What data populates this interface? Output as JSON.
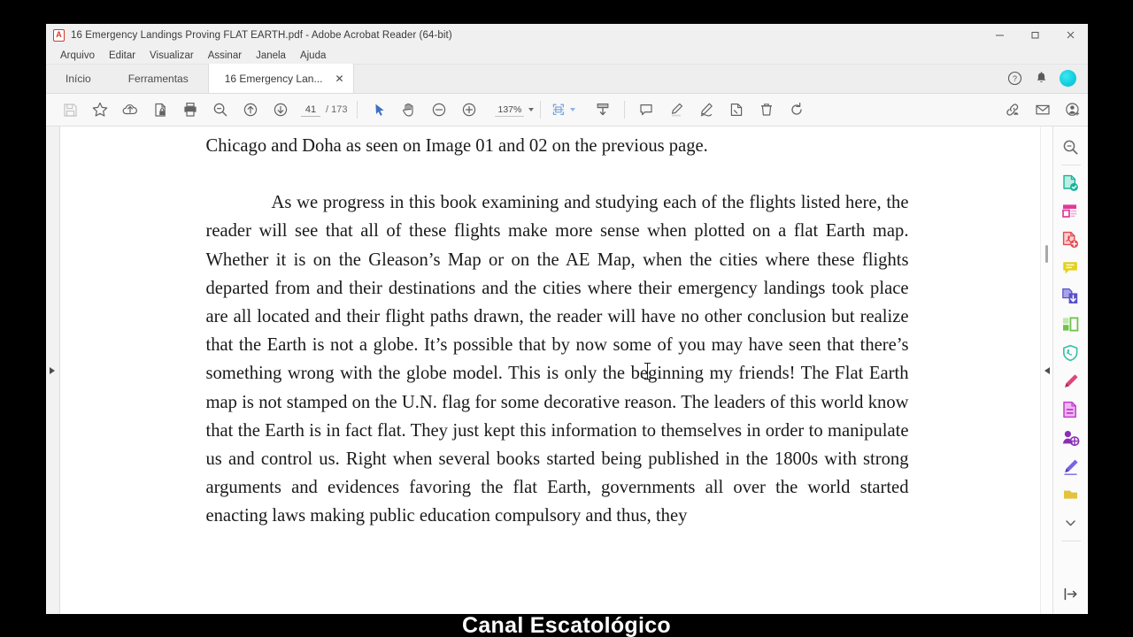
{
  "window": {
    "app_icon_glyph": "A",
    "title": "16 Emergency Landings Proving FLAT EARTH.pdf - Adobe Acrobat Reader (64-bit)",
    "controls": {
      "minimize": "–",
      "restore": "❐",
      "close": "✕"
    }
  },
  "menubar": {
    "items": [
      {
        "label": "Arquivo"
      },
      {
        "label": "Editar"
      },
      {
        "label": "Visualizar"
      },
      {
        "label": "Assinar"
      },
      {
        "label": "Janela"
      },
      {
        "label": "Ajuda"
      }
    ]
  },
  "tabs": {
    "home": "Início",
    "tools": "Ferramentas",
    "document": "16 Emergency Lan...",
    "close_glyph": "✕",
    "right_icons": [
      {
        "name": "help-icon",
        "glyph": "?"
      },
      {
        "name": "notification-bell-icon",
        "glyph": "🔔"
      },
      {
        "name": "user-avatar",
        "glyph": ""
      }
    ]
  },
  "toolbar": {
    "icons": [
      {
        "name": "save-icon",
        "label": "Salvar"
      },
      {
        "name": "star-bookmark-icon",
        "label": "Favorito"
      },
      {
        "name": "cloud-upload-icon",
        "label": "Enviar para nuvem"
      },
      {
        "name": "protect-document-icon",
        "label": "Proteger"
      },
      {
        "name": "print-icon",
        "label": "Imprimir"
      },
      {
        "name": "search-zoom-icon",
        "label": "Pesquisar"
      },
      {
        "name": "previous-page-icon",
        "label": "Página anterior"
      },
      {
        "name": "next-page-icon",
        "label": "Próxima página"
      }
    ],
    "page_current": "41",
    "page_separator": "/",
    "page_total": "173",
    "cursor_tools": [
      {
        "name": "select-tool-icon",
        "label": "Selecionar",
        "active": true
      },
      {
        "name": "hand-tool-icon",
        "label": "Mão"
      }
    ],
    "zoom_out": {
      "name": "zoom-out-icon",
      "label": "Reduzir"
    },
    "zoom_in": {
      "name": "zoom-in-icon",
      "label": "Ampliar"
    },
    "zoom_level": "137%",
    "fit_page": {
      "name": "fit-page-icon",
      "label": "Ajustar página"
    },
    "scroll_mode": {
      "name": "scroll-mode-icon",
      "label": "Modo de rolagem"
    },
    "annotate_icons": [
      {
        "name": "comment-icon",
        "label": "Comentário"
      },
      {
        "name": "highlight-icon",
        "label": "Realce"
      },
      {
        "name": "draw-icon",
        "label": "Desenhar"
      },
      {
        "name": "stamp-icon",
        "label": "Carimbo"
      },
      {
        "name": "delete-icon",
        "label": "Excluir"
      },
      {
        "name": "rotate-icon",
        "label": "Girar"
      }
    ],
    "share_icons": [
      {
        "name": "share-link-icon",
        "label": "Compartilhar link"
      },
      {
        "name": "email-icon",
        "label": "Enviar por e-mail"
      },
      {
        "name": "add-person-icon",
        "label": "Adicionar pessoa"
      }
    ]
  },
  "right_rail": {
    "items": [
      {
        "name": "search-document-icon",
        "label": "Pesquisar documento",
        "color": "#6d6d6d"
      },
      {
        "name": "export-pdf-icon",
        "label": "Exportar PDF",
        "color": "#17b39b"
      },
      {
        "name": "organize-pages-icon",
        "label": "Organizar páginas",
        "color": "#e0399a"
      },
      {
        "name": "create-pdf-icon",
        "label": "Criar PDF",
        "color": "#e5484d"
      },
      {
        "name": "comment-tool-icon",
        "label": "Comentário",
        "color": "#d6c020"
      },
      {
        "name": "combine-files-icon",
        "label": "Combinar arquivos",
        "color": "#5a52c9"
      },
      {
        "name": "compress-pdf-icon",
        "label": "Compactar PDF",
        "color": "#6ec34a"
      },
      {
        "name": "protect-pdf-icon",
        "label": "Proteger PDF",
        "color": "#37bfa7"
      },
      {
        "name": "fill-sign-icon",
        "label": "Preencher e assinar",
        "color": "#e0447a"
      },
      {
        "name": "edit-pdf-icon",
        "label": "Editar PDF",
        "color": "#c53bd0"
      },
      {
        "name": "request-signature-icon",
        "label": "Solicitar assinatura",
        "color": "#8a2fb5"
      },
      {
        "name": "stamp-tool-icon",
        "label": "Carimbo",
        "color": "#7a63e0"
      },
      {
        "name": "more-tools-icon",
        "label": "Mais ferramentas",
        "color": "#d4b11f"
      }
    ],
    "expand_glyph": "∨",
    "collapse_panel": {
      "name": "collapse-panel-icon",
      "glyph": "⇥"
    }
  },
  "document": {
    "line_top_clipped": "Chicago and Doha as seen on Image 01 and 02 on the previous page.",
    "paragraph": "As we progress in this book examining and studying each of the flights listed here, the reader will see that all of these flights make more sense when plotted on a flat Earth map. Whether it is on the Gleason’s Map or on the AE Map, when the cities where these flights departed from and their destinations and the cities where their emergency landings took place are all located and their flight paths drawn, the reader will have no other conclusion but realize that the Earth is not a globe. It’s possible that by now some of you may have seen that there’s something wrong with the globe model. This is only the beginning my friends! The Flat Earth map is not stamped on the U.N. flag for some decorative reason. The leaders of this world know that the Earth is in fact flat. They just kept this information to themselves in order to manipulate us and control us. Right when several books started being published in the 1800s with strong arguments and evidences favoring the flat Earth, governments all over the world started enacting laws making public education compulsory and thus, they"
  },
  "caption": {
    "text": "Canal Escatológico"
  }
}
